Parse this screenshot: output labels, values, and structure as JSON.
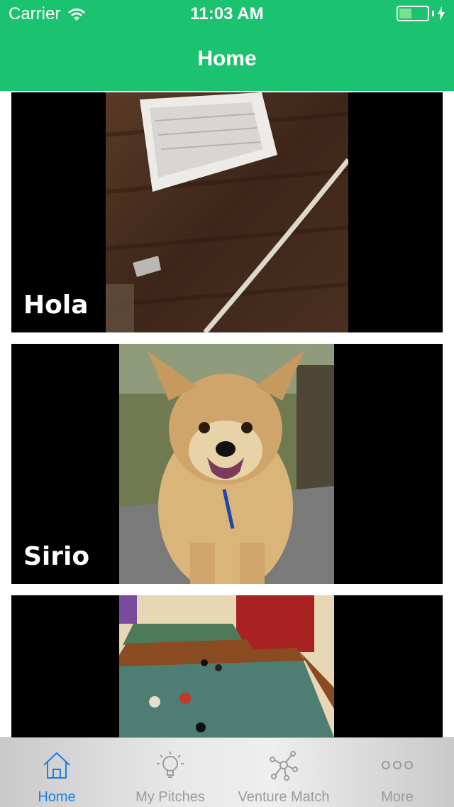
{
  "status_bar": {
    "carrier": "Carrier",
    "time": "11:03 AM"
  },
  "nav": {
    "title": "Home"
  },
  "feed": {
    "items": [
      {
        "title": "Hola",
        "image": "notebook-on-table-photo"
      },
      {
        "title": "Sirio",
        "image": "dog-photo"
      },
      {
        "title": "",
        "image": "pool-table-photo"
      }
    ]
  },
  "tabbar": {
    "tabs": [
      {
        "label": "Home",
        "icon": "house-icon",
        "active": true
      },
      {
        "label": "My Pitches",
        "icon": "lightbulb-icon",
        "active": false
      },
      {
        "label": "Venture Match",
        "icon": "network-icon",
        "active": false
      },
      {
        "label": "More",
        "icon": "more-dots-icon",
        "active": false
      }
    ]
  },
  "colors": {
    "header": "#1bc270",
    "active_tab": "#1a7fe6",
    "inactive_tab": "#9b9b9b"
  }
}
